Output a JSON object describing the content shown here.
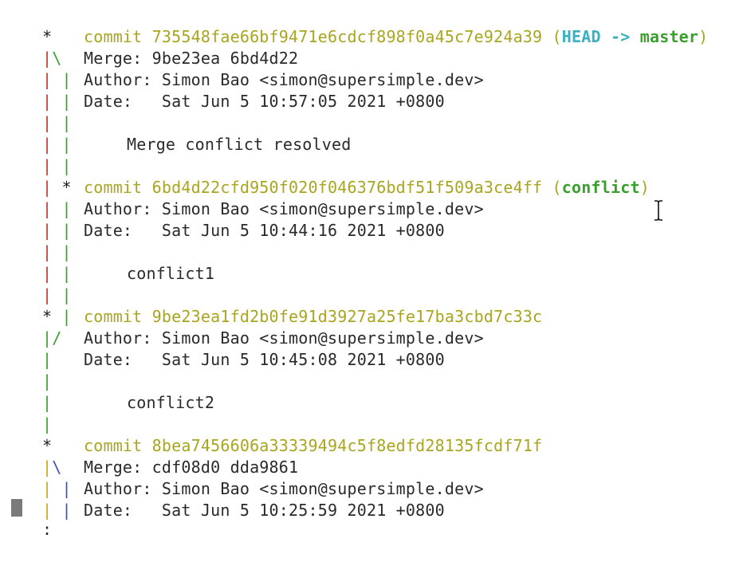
{
  "terminal": {
    "prompt": ":",
    "commits": [
      {
        "hash_line": "commit 735548fae66bf9471e6cdcf898f0a45c7e924a39",
        "refs_open": " (",
        "ref_head": "HEAD -> ",
        "ref_branch": "master",
        "refs_close": ")",
        "merge": "Merge: 9be23ea 6bd4d22",
        "author": "Author: Simon Bao <simon@supersimple.dev>",
        "date": "Date:   Sat Jun 5 10:57:05 2021 +0800",
        "message": "Merge conflict resolved"
      },
      {
        "hash_line": "commit 6bd4d22cfd950f020f046376bdf51f509a3ce4ff",
        "refs_open": " (",
        "ref_branch": "conflict",
        "refs_close": ")",
        "author": "Author: Simon Bao <simon@supersimple.dev>",
        "date": "Date:   Sat Jun 5 10:44:16 2021 +0800",
        "message": "conflict1"
      },
      {
        "hash_line": "commit 9be23ea1fd2b0fe91d3927a25fe17ba3cbd7c33c",
        "author": "Author: Simon Bao <simon@supersimple.dev>",
        "date": "Date:   Sat Jun 5 10:45:08 2021 +0800",
        "message": "conflict2"
      },
      {
        "hash_line": "commit 8bea7456606a33339494c5f8edfd28135fcdf71f",
        "merge": "Merge: cdf08d0 dda9861",
        "author": "Author: Simon Bao <simon@supersimple.dev>",
        "date": "Date:   Sat Jun 5 10:25:59 2021 +0800"
      }
    ]
  }
}
